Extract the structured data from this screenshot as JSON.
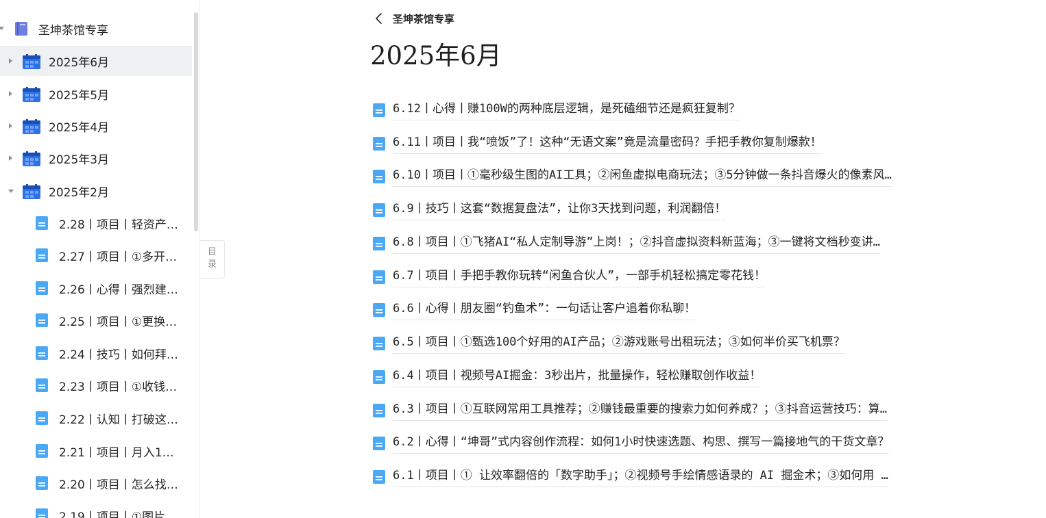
{
  "sidebar": {
    "root": {
      "label": "圣坤茶馆专享"
    },
    "months": [
      {
        "label": "2025年6月",
        "expanded": false,
        "selected": true
      },
      {
        "label": "2025年5月",
        "expanded": false,
        "selected": false
      },
      {
        "label": "2025年4月",
        "expanded": false,
        "selected": false
      },
      {
        "label": "2025年3月",
        "expanded": false,
        "selected": false
      },
      {
        "label": "2025年2月",
        "expanded": true,
        "selected": false
      }
    ],
    "february_docs": [
      "2.28丨项目丨轻资产…",
      "2.27丨项目丨①多开…",
      "2.26丨心得丨强烈建…",
      "2.25丨项目丨①更换…",
      "2.24丨技巧丨如何拜…",
      "2.23丨项目丨①收钱…",
      "2.22丨认知丨打破这…",
      "2.21丨项目丨月入1…",
      "2.20丨项目丨怎么找…",
      "2.19丨项目丨①图片…"
    ]
  },
  "toc_tab": {
    "line1": "目",
    "line2": "录"
  },
  "header": {
    "back_title": "圣坤茶馆专享"
  },
  "page": {
    "title": "2025年6月",
    "articles": [
      "6.12丨心得丨赚100W的两种底层逻辑，是死磕细节还是疯狂复制？",
      "6.11丨项目丨我“喷饭”了！这种“无语文案”竟是流量密码？手把手教你复制爆款！",
      "6.10丨项目丨①毫秒级生图的AI工具；②闲鱼虚拟电商玩法；③5分钟做一条抖音爆火的像素风…",
      "6.9丨技巧丨这套“数据复盘法”，让你3天找到问题，利润翻倍！",
      "6.8丨项目丨①飞猪AI“私人定制导游”上岗！；②抖音虚拟资料新蓝海；③一键将文档秒变讲…",
      "6.7丨项目丨手把手教你玩转“闲鱼合伙人”，一部手机轻松搞定零花钱！",
      "6.6丨心得丨朋友圈“钓鱼术”：一句话让客户追着你私聊！",
      "6.5丨项目丨①甄选100个好用的AI产品；②游戏账号出租玩法；③如何半价买飞机票？",
      "6.4丨项目丨视频号AI掘金：3秒出片，批量操作，轻松赚取创作收益！",
      "6.3丨项目丨①互联网常用工具推荐；②赚钱最重要的搜索力如何养成？；③抖音运营技巧：算…",
      "6.2丨心得丨“坤哥”式内容创作流程：如何1小时快速选题、构思、撰写一篇接地气的干货文章？",
      "6.1丨项目丨① 让效率翻倍的「数字助手」；②视频号手绘情感语录的 AI 掘金术；③如何用 …"
    ]
  },
  "colors": {
    "selected_row_bg": "#eff0f2",
    "doc_icon": "#4aa8f5",
    "calendar_icon": "#2f6fe4",
    "book_icon": "#6f7fe0"
  }
}
